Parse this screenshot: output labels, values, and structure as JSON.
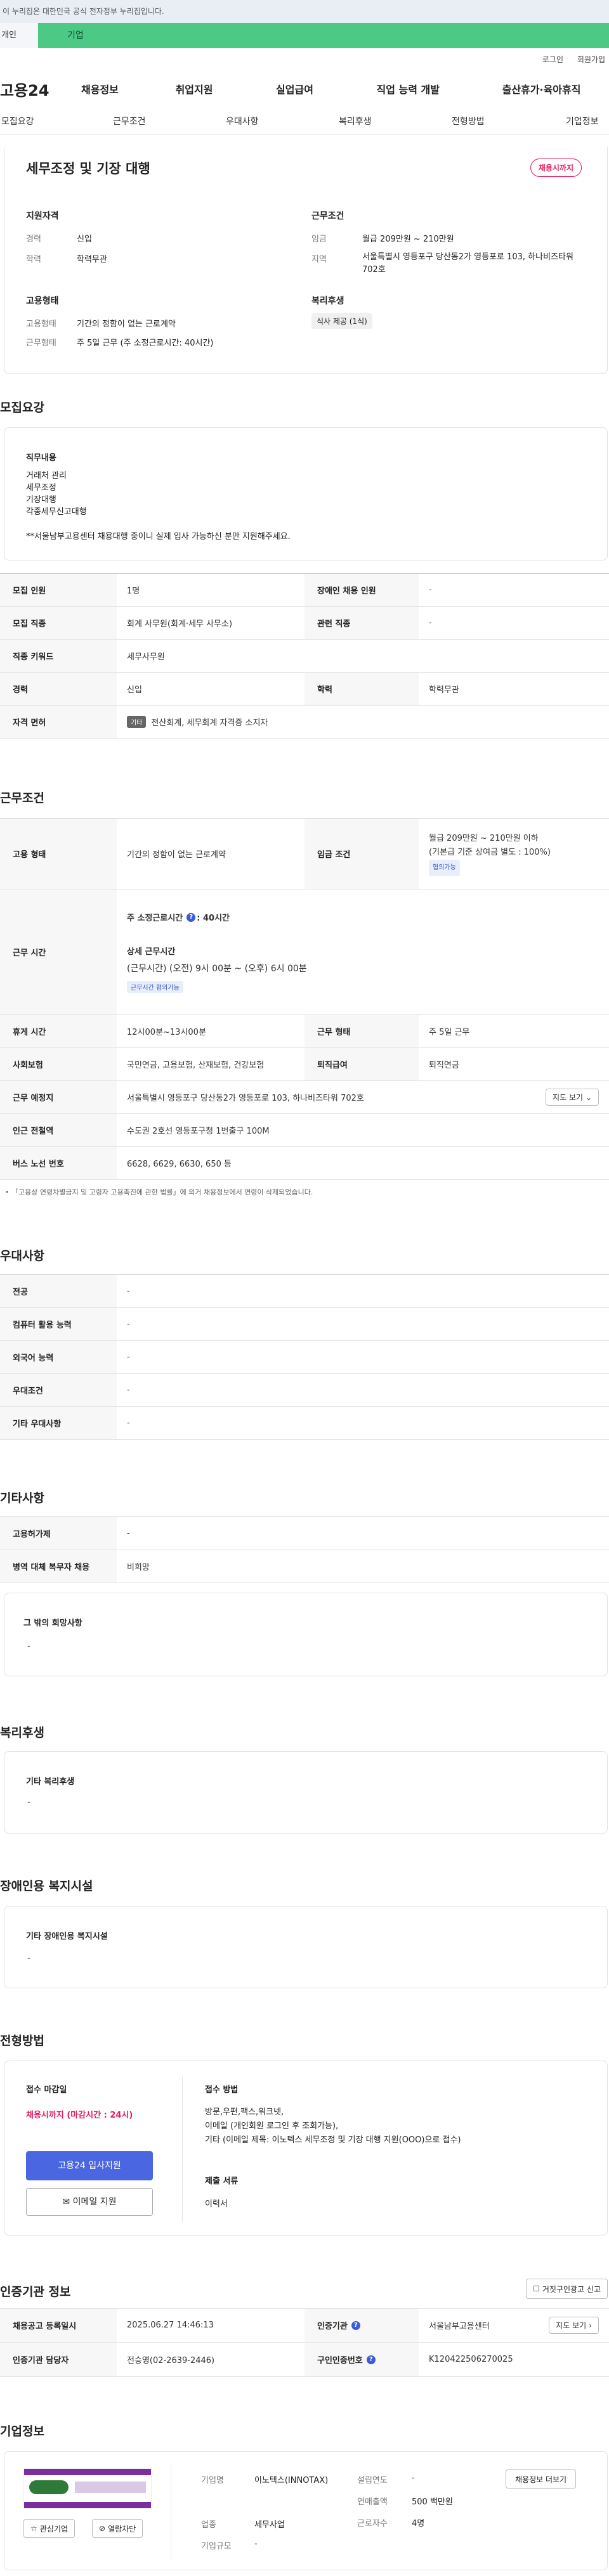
{
  "gov_notice": "이 누리집은 대한민국 공식 전자정부 누리집입니다.",
  "tabs": {
    "person": "개인",
    "company": "기업"
  },
  "util": {
    "login": "로그인",
    "signup": "회원가입"
  },
  "logo": "고용24",
  "gnb": [
    "채용정보",
    "취업지원",
    "실업급여",
    "직업 능력 개발",
    "출산휴가·육아휴직"
  ],
  "subnav": [
    "모집요강",
    "근무조건",
    "우대사항",
    "복리후생",
    "전형방법",
    "기업정보"
  ],
  "job": {
    "title": "세무조정 및 기장 대행",
    "status_badge": "채용시까지",
    "support_h": "지원자격",
    "career_l": "경력",
    "career_v": "신입",
    "edu_l": "학력",
    "edu_v": "학력무관",
    "cond_h": "근무조건",
    "wage_l": "임금",
    "wage_v": "월급 209만원 ~ 210만원",
    "area_l": "지역",
    "area_v": "서울특별시 영등포구 당산동2가 영등포로 103, 하나비즈타워 702호",
    "emp_h": "고용형태",
    "emp_l": "고용형태",
    "emp_v": "기간의 정함이 없는 근로계약",
    "work_l": "근무형태",
    "work_v": "주 5일 근무 (주 소정근로시간: 40시간)",
    "welfare_h": "복리후생",
    "welfare_tag": "식사 제공 (1식)"
  },
  "recruit": {
    "title": "모집요강",
    "duty_h": "직무내용",
    "duty_lines": [
      "거래처 관리",
      "세무조정",
      "기장대행",
      "각종세무신고대행"
    ],
    "duty_note": "**서울남부고용센터 채용대행 중이니 실제 입사 가능하신 분만 지원해주세요.",
    "rows": [
      {
        "k1": "모집 인원",
        "v1": "1명",
        "k2": "장애인 채용 인원",
        "v2": "-"
      },
      {
        "k1": "모집 직종",
        "v1": "회계 사무원(회계·세무 사무소)",
        "k2": "관련 직종",
        "v2": "-"
      },
      {
        "k1": "직종 키워드",
        "v1": "세무사무원"
      },
      {
        "k1": "경력",
        "v1": "신입",
        "k2": "학력",
        "v2": "학력무관"
      },
      {
        "k1": "자격 면허",
        "tag": "기타",
        "v1": "전산회계, 세무회계 자격증 소지자"
      }
    ]
  },
  "work": {
    "title": "근무조건",
    "emp_k": "고용 형태",
    "emp_v": "기간의 정함이 없는 근로계약",
    "wage_k": "임금 조건",
    "wage_v1": "월급 209만원 ~ 210만원 이하",
    "wage_v2": "(기본급 기준 상여금 별도 : 100%)",
    "wage_tag": "협의가능",
    "hours_k": "근무 시간",
    "hours_main": "주 소정근로시간",
    "hours_val": ": 40시간",
    "hours_detail_h": "상세 근무시간",
    "hours_detail": "(근무시간) (오전) 9시 00분 ~ (오후) 6시 00분",
    "hours_tag": "근무시간 협의가능",
    "rest_k": "휴게 시간",
    "rest_v": "12시00분~13시00분",
    "form_k": "근무 형태",
    "form_v": "주 5일 근무",
    "ins_k": "사회보험",
    "ins_v": "국민연금, 고용보험, 산재보험, 건강보험",
    "ret_k": "퇴직급여",
    "ret_v": "퇴직연금",
    "place_k": "근무 예정지",
    "place_v": "서울특별시 영등포구 당산동2가 영등포로 103, 하나비즈타워 702호",
    "map_btn": "지도 보기",
    "subway_k": "인근 전철역",
    "subway_v": "수도권 2호선 영등포구청 1번출구 100M",
    "bus_k": "버스 노선 번호",
    "bus_v": "6628, 6629, 6630, 650 등",
    "notice": "「고용상 연령차별금지 및 고령자 고용촉진에 관한 법률」에 의거 채용정보에서 연령이 삭제되었습니다."
  },
  "pref": {
    "title": "우대사항",
    "rows": [
      {
        "k": "전공",
        "v": "-"
      },
      {
        "k": "컴퓨터 활용 능력",
        "v": "-"
      },
      {
        "k": "외국어 능력",
        "v": "-"
      },
      {
        "k": "우대조건",
        "v": "-"
      },
      {
        "k": "기타 우대사항",
        "v": "-"
      }
    ]
  },
  "etc": {
    "title": "기타사항",
    "rows": [
      {
        "k": "고용허가제",
        "v": "-"
      },
      {
        "k": "병역 대체 복무자 채용",
        "v": "비희망"
      }
    ],
    "extra_h": "그 밖의 희망사항",
    "extra_v": "-"
  },
  "benefit": {
    "title": "복리후생",
    "h": "기타 복리후생",
    "v": "-"
  },
  "disab": {
    "title": "장애인용 복지시설",
    "h": "기타 장애인용 복지시설",
    "v": "-"
  },
  "screen": {
    "title": "전형방법",
    "deadline_h": "접수 마감일",
    "deadline_v": "채용시까지 (마감시간 : 24시)",
    "apply_btn": "고용24 입사지원",
    "email_btn": "이메일 지원",
    "method_h": "접수 방법",
    "method_lines": [
      "방문,우편,팩스,워크넷,",
      "이메일 (개인회원 로그인 후 조회가능),",
      "기타 (이메일 제목: 이노텍스 세무조정 및 기장 대행 지원(OOO)으로 접수)"
    ],
    "docs_h": "제출 서류",
    "docs_v": "이력서"
  },
  "cert": {
    "title": "인증기관 정보",
    "report_btn": "거짓구인광고 신고",
    "reg_k": "채용공고 등록일시",
    "reg_v": "2025.06.27 14:46:13",
    "org_k": "인증기관",
    "org_v": "서울남부고용센터",
    "map_btn": "지도 보기",
    "mgr_k": "인증기관 담당자",
    "mgr_v": "전승영(02-2639-2446)",
    "no_k": "구인인증번호",
    "no_v": "K120422506270025"
  },
  "company": {
    "title": "기업정보",
    "like_btn": "관심기업",
    "block_btn": "열람차단",
    "name_k": "기업명",
    "name_v": "이노텍스(INNOTAX)",
    "ind_k": "업종",
    "ind_v": "세무사업",
    "size_k": "기업규모",
    "size_v": "-",
    "est_k": "설립연도",
    "est_v": "-",
    "sales_k": "연매출액",
    "sales_v": "500 백만원",
    "emp_k": "근로자수",
    "emp_v": "4명",
    "list_btn": "채용정보 더보기"
  }
}
